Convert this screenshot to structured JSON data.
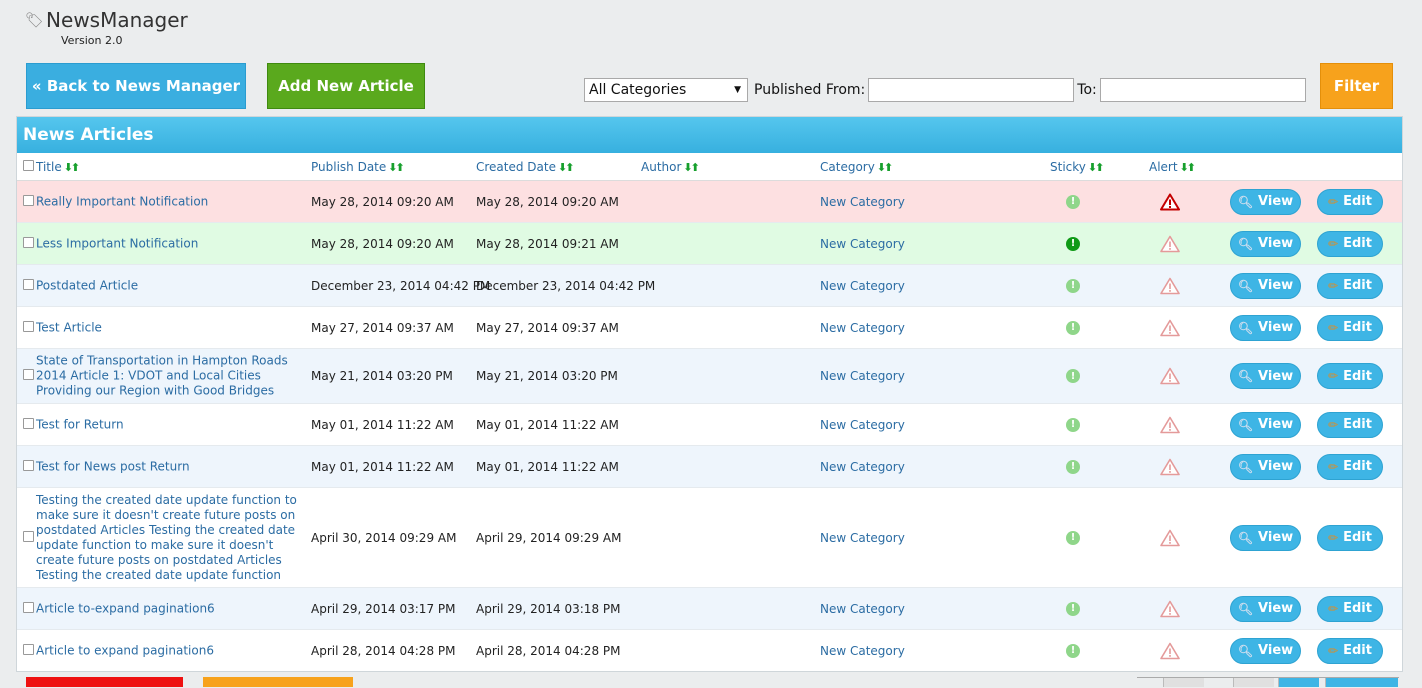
{
  "app": {
    "title": "NewsManager",
    "version": "Version 2.0"
  },
  "toolbar": {
    "back_label": "« Back to News Manager",
    "add_label": "Add New Article",
    "filter_label": "Filter"
  },
  "filter": {
    "category_selected": "All Categories",
    "published_from_label": "Published From:",
    "published_from_value": "",
    "to_label": "To:",
    "to_value": ""
  },
  "panel": {
    "title": "News Articles"
  },
  "columns": {
    "title": "Title",
    "publish_date": "Publish Date",
    "created_date": "Created Date",
    "author": "Author",
    "category": "Category",
    "sticky": "Sticky",
    "alert": "Alert"
  },
  "actions": {
    "view": "View",
    "edit": "Edit"
  },
  "colors": {
    "row_alert": "#fde0e1",
    "row_sticky": "#e0fbe3",
    "row_alt": "#eef5fc",
    "row_plain": "#ffffff",
    "accent_blue": "#3eb5e5",
    "add_green": "#5aa91d",
    "filter_orange": "#f7a21c"
  },
  "articles": [
    {
      "title": "Really Important Notification",
      "publish": "May 28, 2014 09:20 AM",
      "created": "May 28, 2014 09:20 AM",
      "author": "",
      "category": "New Category",
      "sticky": false,
      "alert": true,
      "tone": "alert"
    },
    {
      "title": "Less Important Notification",
      "publish": "May 28, 2014 09:20 AM",
      "created": "May 28, 2014 09:21 AM",
      "author": "",
      "category": "New Category",
      "sticky": true,
      "alert": false,
      "tone": "sticky"
    },
    {
      "title": "Postdated Article",
      "publish": "December 23, 2014 04:42 PM",
      "created": "December 23, 2014 04:42 PM",
      "author": "",
      "category": "New Category",
      "sticky": false,
      "alert": false,
      "tone": "alt"
    },
    {
      "title": "Test Article",
      "publish": "May 27, 2014 09:37 AM",
      "created": "May 27, 2014 09:37 AM",
      "author": "",
      "category": "New Category",
      "sticky": false,
      "alert": false,
      "tone": "plain"
    },
    {
      "title": "State of Transportation in Hampton Roads 2014 Article 1: VDOT and Local Cities Providing our Region with Good Bridges",
      "publish": "May 21, 2014 03:20 PM",
      "created": "May 21, 2014 03:20 PM",
      "author": "",
      "category": "New Category",
      "sticky": false,
      "alert": false,
      "tone": "alt"
    },
    {
      "title": "Test for Return",
      "publish": "May 01, 2014 11:22 AM",
      "created": "May 01, 2014 11:22 AM",
      "author": "",
      "category": "New Category",
      "sticky": false,
      "alert": false,
      "tone": "plain"
    },
    {
      "title": "Test for News post Return",
      "publish": "May 01, 2014 11:22 AM",
      "created": "May 01, 2014 11:22 AM",
      "author": "",
      "category": "New Category",
      "sticky": false,
      "alert": false,
      "tone": "alt"
    },
    {
      "title": "Testing the created date update function to make sure it doesn't create future posts on postdated Articles Testing the created date update function to make sure it doesn't create future posts on postdated Articles Testing the created date update function",
      "publish": "April 30, 2014 09:29 AM",
      "created": "April 29, 2014 09:29 AM",
      "author": "",
      "category": "New Category",
      "sticky": false,
      "alert": false,
      "tone": "plain"
    },
    {
      "title": "Article to-expand pagination6",
      "publish": "April 29, 2014 03:17 PM",
      "created": "April 29, 2014 03:18 PM",
      "author": "",
      "category": "New Category",
      "sticky": false,
      "alert": false,
      "tone": "alt"
    },
    {
      "title": "Article to expand pagination6",
      "publish": "April 28, 2014 04:28 PM",
      "created": "April 28, 2014 04:28 PM",
      "author": "",
      "category": "New Category",
      "sticky": false,
      "alert": false,
      "tone": "plain"
    }
  ]
}
